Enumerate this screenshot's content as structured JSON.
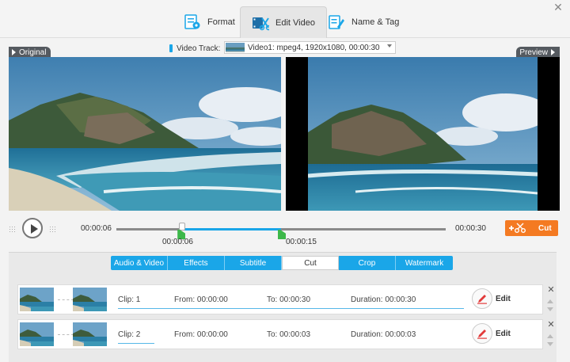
{
  "tabs": [
    {
      "label": "Format",
      "icon": "format-icon"
    },
    {
      "label": "Edit Video",
      "icon": "edit-video-icon"
    },
    {
      "label": "Name & Tag",
      "icon": "name-tag-icon"
    }
  ],
  "video_track": {
    "label": "Video Track:",
    "selected": "Video1: mpeg4, 1920x1080, 00:00:30"
  },
  "panels": {
    "original": "Original",
    "preview": "Preview"
  },
  "player": {
    "current_time": "00:00:06",
    "total_time": "00:00:30",
    "start_marker": "00:00:06",
    "end_marker": "00:00:15",
    "playhead_fraction": 0.2,
    "start_fraction": 0.2,
    "end_fraction": 0.5,
    "cut_label": "Cut"
  },
  "edit_tabs": [
    "Audio & Video",
    "Effects",
    "Subtitle",
    "Cut",
    "Crop",
    "Watermark"
  ],
  "active_edit_tab": "Cut",
  "clips": [
    {
      "clip": "Clip: 1",
      "from": "From: 00:00:00",
      "to": "To: 00:00:30",
      "duration": "Duration: 00:00:30",
      "edit_label": "Edit"
    },
    {
      "clip": "Clip: 2",
      "from": "From: 00:00:00",
      "to": "To: 00:00:03",
      "duration": "Duration: 00:00:03",
      "edit_label": "Edit"
    }
  ],
  "colors": {
    "accent": "#1aa6e8",
    "cut": "#f47a22",
    "marker": "#3db84a"
  }
}
